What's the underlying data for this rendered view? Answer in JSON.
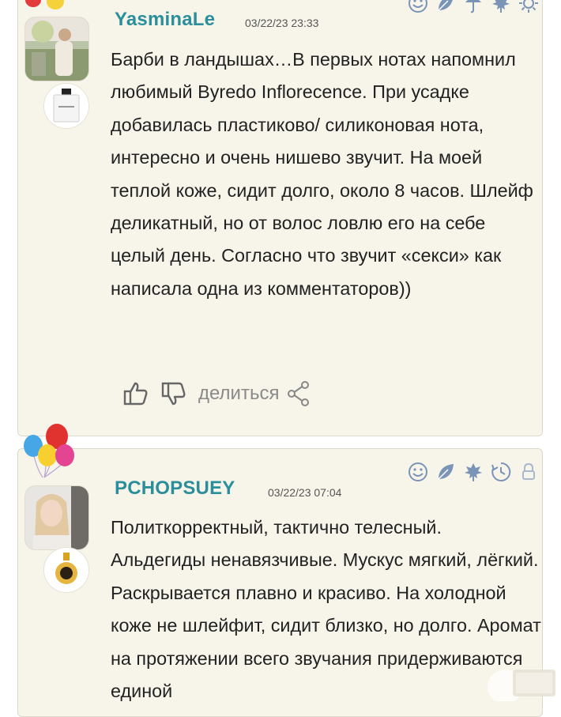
{
  "reviews": [
    {
      "username": "YasminaLe",
      "date": "03/22/23 23:33",
      "text": "Барби в ландышах…В первых нотах напомнил любимый Byredo Inflorecence. При усадке добавилась пластиково/ силиконовая нота, интересно и очень нишево звучит. На моей теплой коже, сидит долго, около 8 часов. Шлейф деликатный, но от волос ловлю его на себе целый день. Согласно что звучит «секси» как написала одна из комментаторов))",
      "share_label": "делиться",
      "icons": [
        "smile-icon",
        "leaf-icon",
        "rain-icon",
        "maple-leaf-icon",
        "sun-icon"
      ]
    },
    {
      "username": "PCHOPSUEY",
      "date": "03/22/23 07:04",
      "text": "Политкорректный, тактично телесный. Альдегиды ненавязчивые. Мускус мягкий, лёгкий. Раскрывается плавно и красиво. На холодной коже не шлейфит, сидит близко, но долго. Аромат на протяжении всего звучания придерживаются единой",
      "icons": [
        "smile-icon",
        "leaf-icon",
        "maple-leaf-icon",
        "clock-icon",
        "lock-icon"
      ]
    }
  ],
  "colors": {
    "username": "#2a8f9b",
    "card_bg": "#f7f4ea",
    "icon": "#7a94b8"
  }
}
